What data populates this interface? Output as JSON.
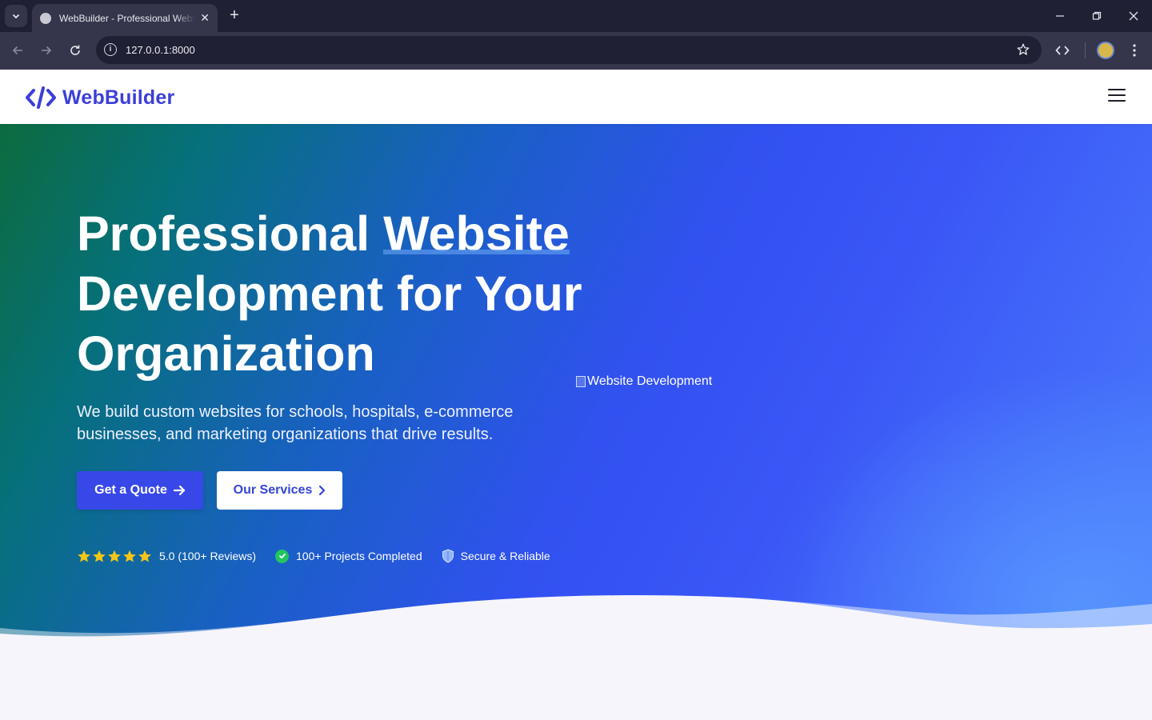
{
  "browser": {
    "tab_title": "WebBuilder - Professional Website Development",
    "url": "127.0.0.1:8000",
    "new_tab_label": "+"
  },
  "site": {
    "logo_text": "WebBuilder",
    "brand_color": "#3b3fd8"
  },
  "hero": {
    "title_part1": "Professional ",
    "title_highlight": "Website",
    "title_part2": "Development for Your Organization",
    "subtitle": "We build custom websites for schools, hospitals, e-commerce businesses, and marketing organizations that drive results.",
    "image_alt": "Website Development",
    "cta_primary": "Get a Quote",
    "cta_secondary": "Our Services",
    "rating": "5.0 (100+ Reviews)",
    "rating_stars": 5,
    "projects": "100+ Projects Completed",
    "secure": "Secure & Reliable"
  },
  "icons": {
    "star_color": "#f5c518",
    "check_color": "#22c55e"
  }
}
